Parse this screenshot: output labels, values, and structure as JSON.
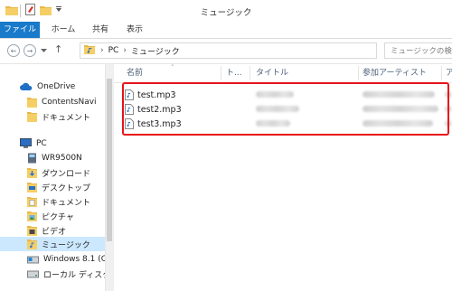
{
  "window": {
    "title": "ミュージック"
  },
  "ribbon": {
    "tabs": [
      "ファイル",
      "ホーム",
      "共有",
      "表示"
    ]
  },
  "address": {
    "path": [
      "PC",
      "ミュージック"
    ]
  },
  "search": {
    "placeholder": "ミュージックの検"
  },
  "nav": {
    "items": [
      {
        "label": "OneDrive",
        "icon": "cloud-icon"
      },
      {
        "label": "ContentsNavi",
        "icon": "folder-icon"
      },
      {
        "label": "ドキュメント",
        "icon": "folder-icon"
      },
      {
        "label": "PC",
        "icon": "computer-icon"
      },
      {
        "label": "WR9500N",
        "icon": "network-drive-icon"
      },
      {
        "label": "ダウンロード",
        "icon": "download-folder-icon"
      },
      {
        "label": "デスクトップ",
        "icon": "desktop-folder-icon"
      },
      {
        "label": "ドキュメント",
        "icon": "documents-folder-icon"
      },
      {
        "label": "ピクチャ",
        "icon": "pictures-folder-icon"
      },
      {
        "label": "ビデオ",
        "icon": "videos-folder-icon"
      },
      {
        "label": "ミュージック",
        "icon": "music-folder-icon",
        "selected": true
      },
      {
        "label": "Windows 8.1 (C",
        "icon": "drive-icon"
      },
      {
        "label": "ローカル ディスク (D",
        "icon": "drive-icon"
      }
    ]
  },
  "columns": [
    "名前",
    "ト...",
    "タイトル",
    "参加アーティスト",
    "ア"
  ],
  "files": [
    {
      "name": "test.mp3"
    },
    {
      "name": "test2.mp3"
    },
    {
      "name": "test3.mp3"
    }
  ],
  "colors": {
    "accent": "#1979ca",
    "selection": "#cce8ff",
    "highlight": "#e8121b"
  }
}
